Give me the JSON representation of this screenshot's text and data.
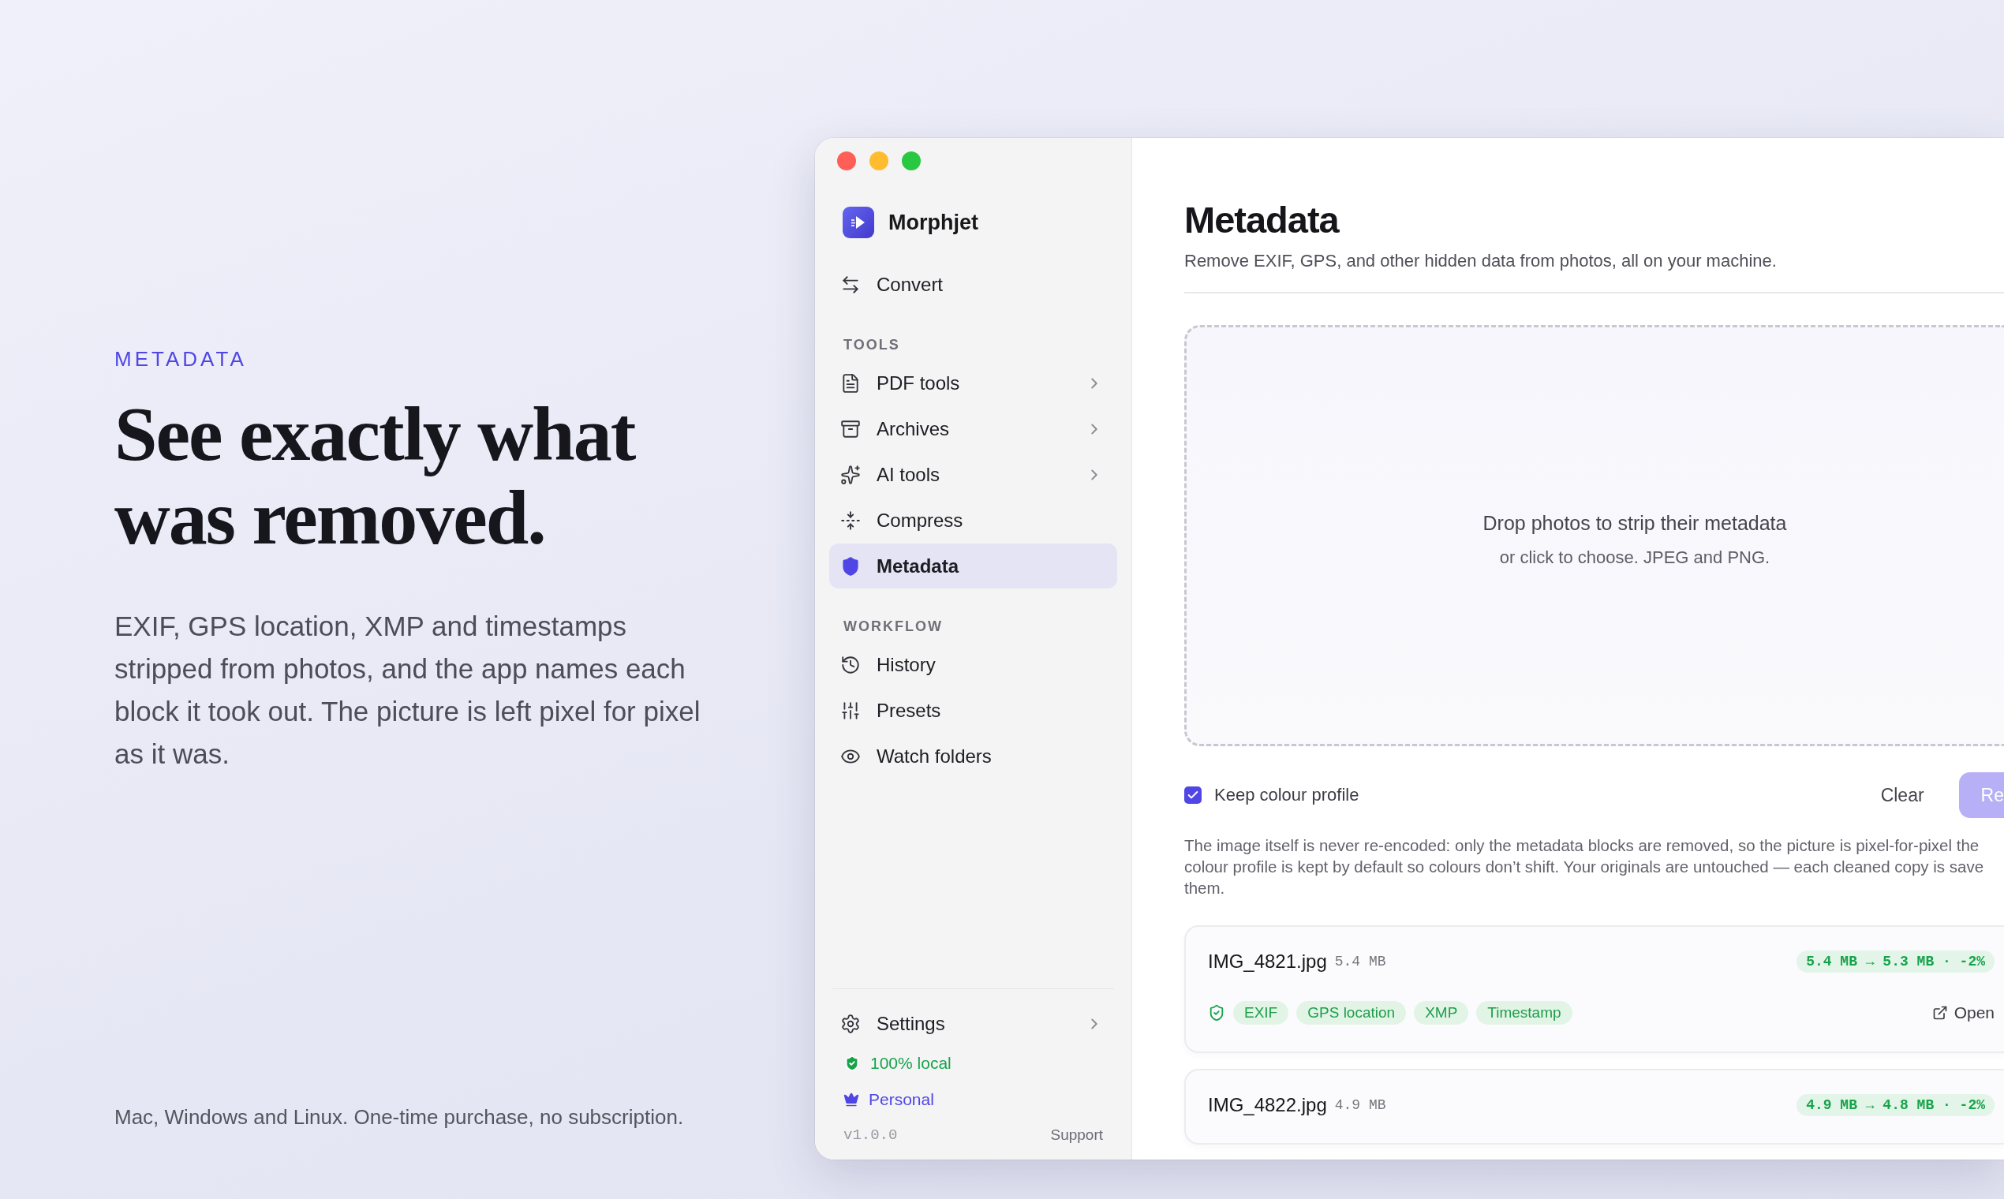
{
  "hero": {
    "eyebrow": "METADATA",
    "headline": "See exactly what was removed.",
    "body": "EXIF, GPS location, XMP and timestamps stripped from photos, and the app names each block it took out. The picture is left pixel for pixel as it was.",
    "footnote": "Mac, Windows and Linux. One-time purchase, no subscription."
  },
  "sidebar": {
    "app_name": "Morphjet",
    "top_items": [
      {
        "label": "Convert",
        "selected": false,
        "expandable": false
      }
    ],
    "sections": [
      {
        "title": "TOOLS",
        "items": [
          {
            "label": "PDF tools",
            "selected": false,
            "expandable": true
          },
          {
            "label": "Archives",
            "selected": false,
            "expandable": true
          },
          {
            "label": "AI tools",
            "selected": false,
            "expandable": true
          },
          {
            "label": "Compress",
            "selected": false,
            "expandable": false
          },
          {
            "label": "Metadata",
            "selected": true,
            "expandable": false
          }
        ]
      },
      {
        "title": "WORKFLOW",
        "items": [
          {
            "label": "History",
            "selected": false,
            "expandable": false
          },
          {
            "label": "Presets",
            "selected": false,
            "expandable": false
          },
          {
            "label": "Watch folders",
            "selected": false,
            "expandable": false
          }
        ]
      }
    ],
    "settings": {
      "label": "Settings",
      "expandable": true
    },
    "local_badge": "100% local",
    "plan": "Personal",
    "version": "v1.0.0",
    "support": "Support"
  },
  "main": {
    "title": "Metadata",
    "subtitle": "Remove EXIF, GPS, and other hidden data from photos, all on your machine.",
    "dropzone": {
      "title": "Drop photos to strip their metadata",
      "hint": "or click to choose. JPEG and PNG."
    },
    "keep_profile": {
      "label": "Keep colour profile",
      "checked": true
    },
    "buttons": [
      {
        "label": "Clear",
        "kind": "ghost",
        "disabled": false
      },
      {
        "label": "Re",
        "kind": "primary",
        "disabled": true
      }
    ],
    "note_lines": [
      "The image itself is never re-encoded: only the metadata blocks are removed, so the picture is pixel-for-pixel the",
      "colour profile is kept by default so colours don’t shift. Your originals are untouched — each cleaned copy is save",
      "them."
    ],
    "files": [
      {
        "name": "IMG_4821.jpg",
        "size": "5.4 MB",
        "result": "5.4 MB → 5.3 MB · -2%",
        "removed": [
          "EXIF",
          "GPS location",
          "XMP",
          "Timestamp"
        ],
        "action": "Open"
      },
      {
        "name": "IMG_4822.jpg",
        "size": "4.9 MB",
        "result": "4.9 MB → 4.8 MB · -2%"
      }
    ]
  }
}
